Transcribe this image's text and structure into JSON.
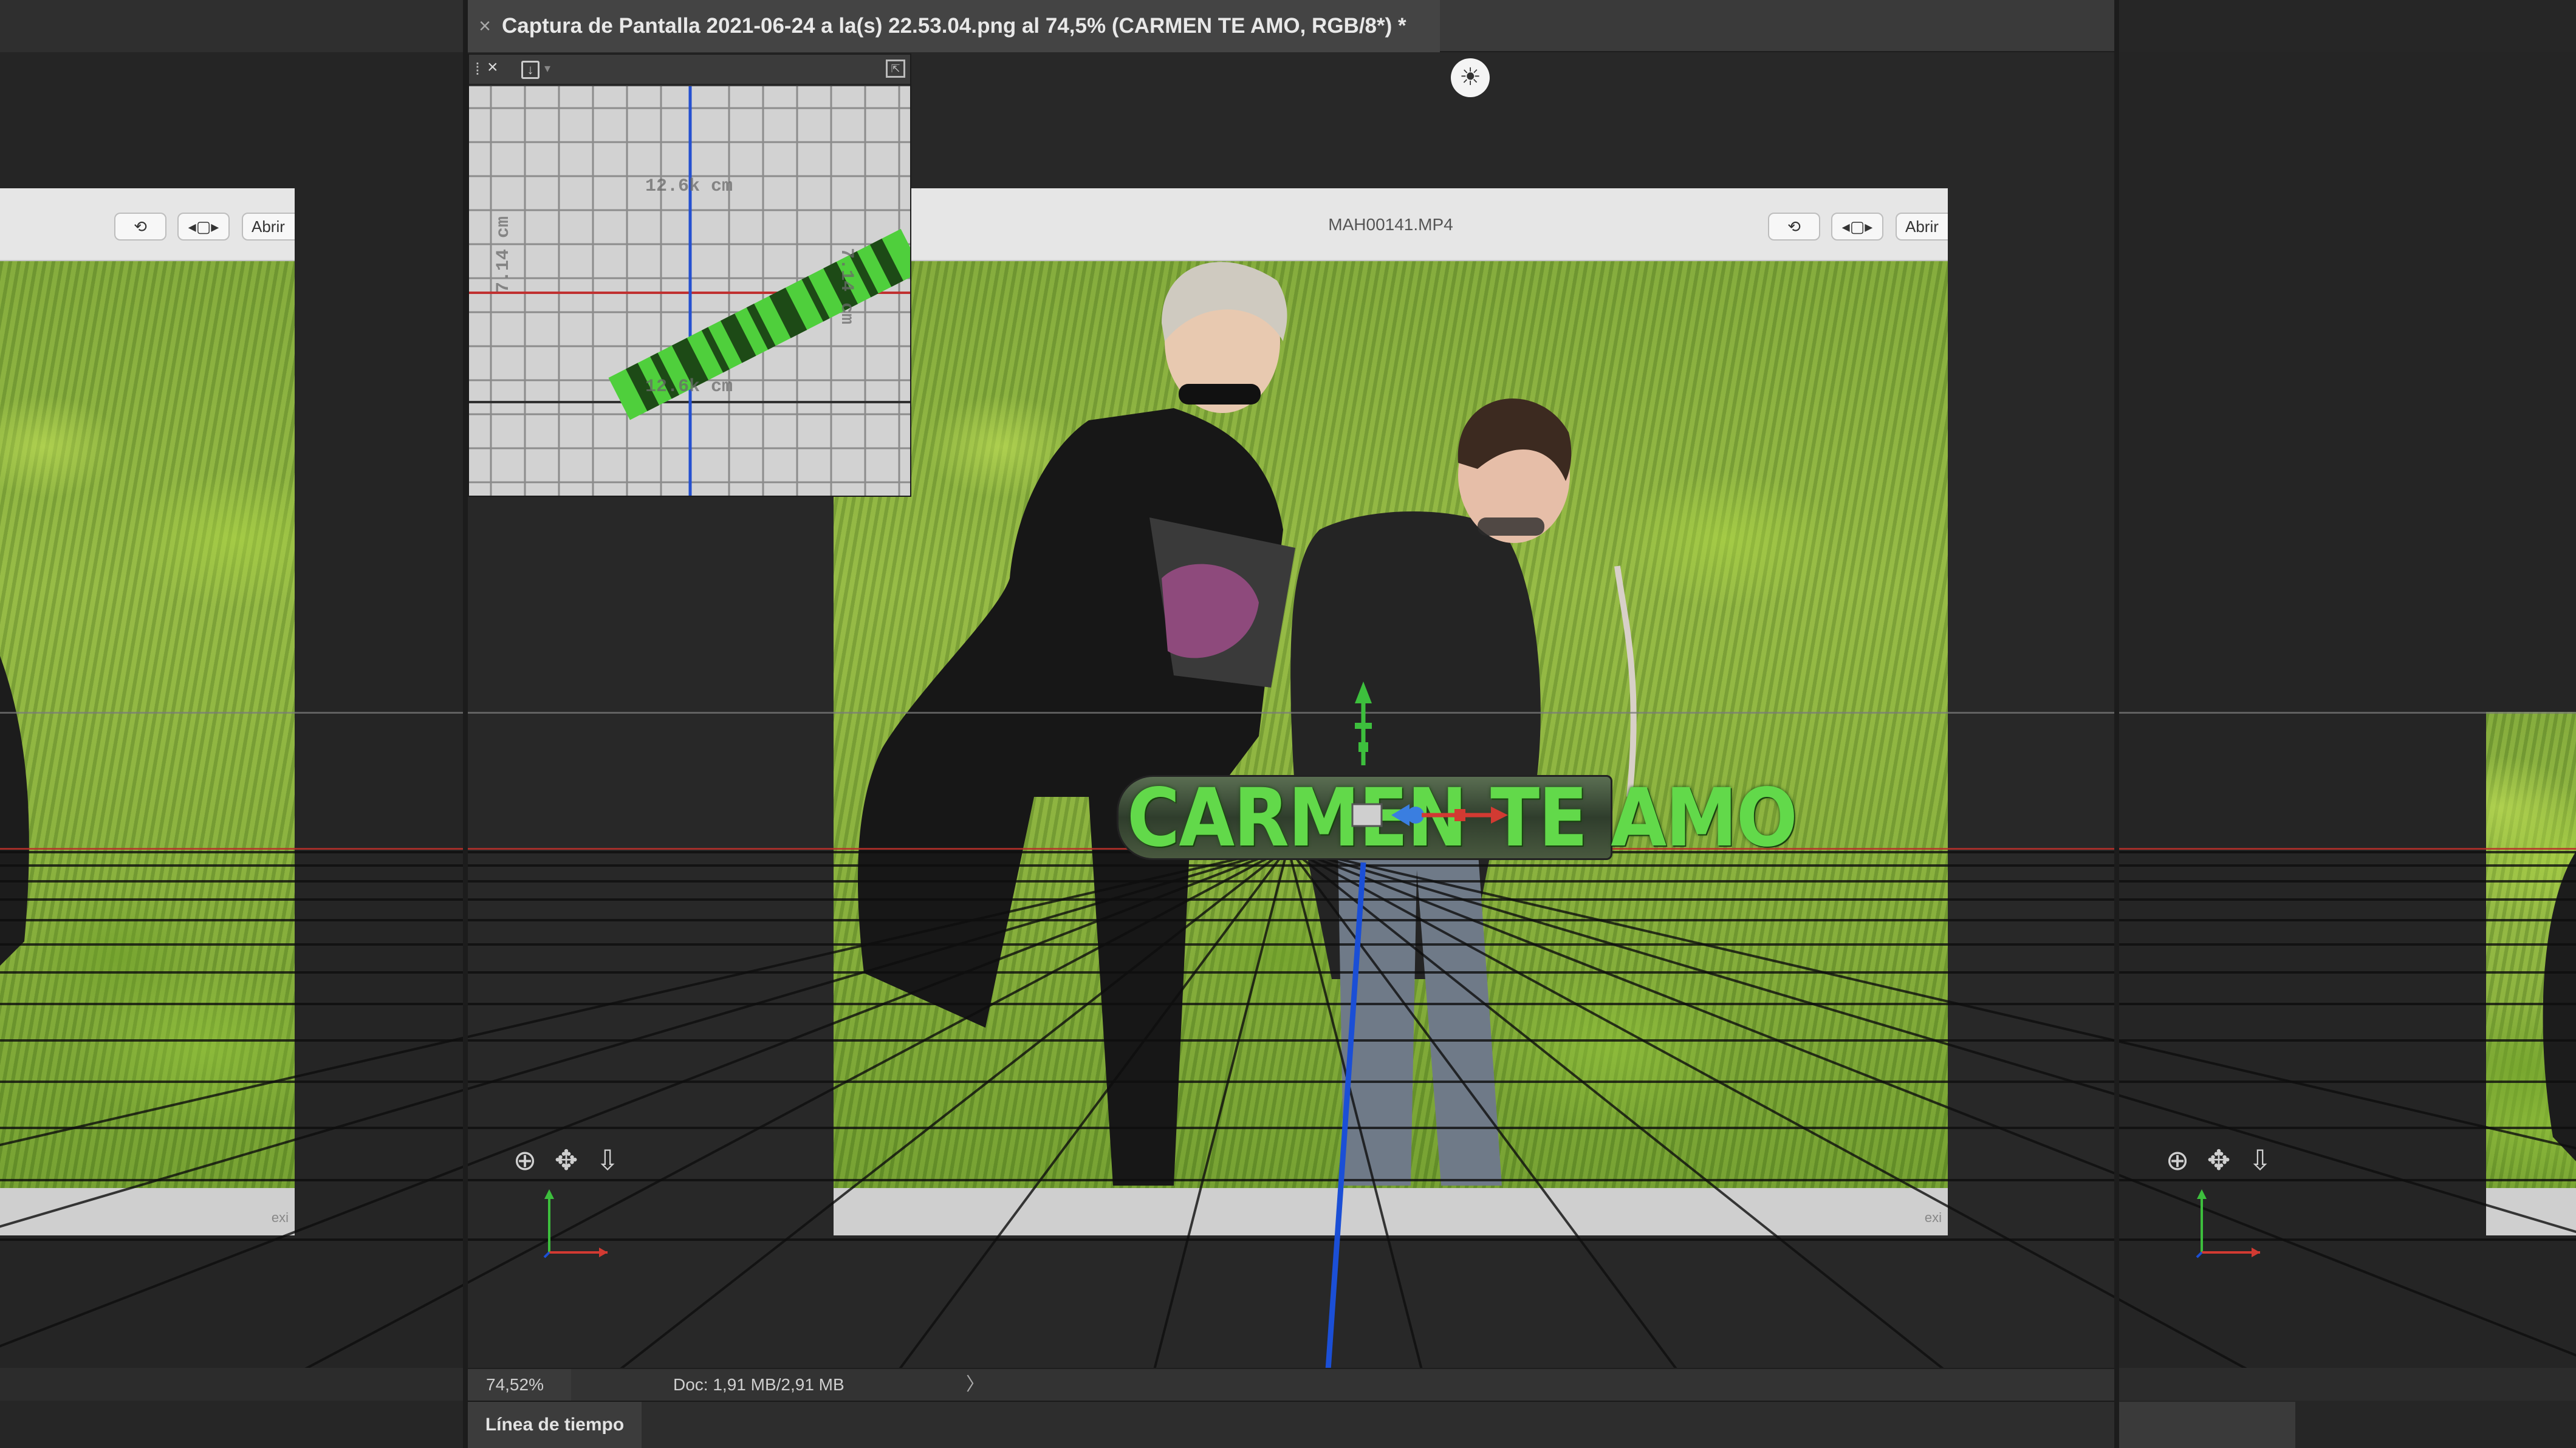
{
  "document_tab": {
    "close_icon": "close-icon",
    "title": "Captura de Pantalla 2021-06-24 a la(s) 22.53.04.png al 74,5% (CARMEN TE AMO, RGB/8*) *"
  },
  "minimap": {
    "close_glyph": "×",
    "grip_glyph": "⁞",
    "icon": "save-view-icon",
    "dropdown_glyph": "▾",
    "expand_icon": "expand-icon",
    "labels": {
      "top": "12.6k cm",
      "bottom": "12.6k cm",
      "left": "7.14 cm",
      "right": "7.14 cm"
    }
  },
  "video_player": {
    "filename": "MAH00141.MP4",
    "open_button": "Abrir",
    "bottom_text": "exi",
    "rotate_icon": "rotate-icon",
    "trim_icon": "trim-icon"
  },
  "text_layer": {
    "text": "CARMEN TE AMO",
    "color": "#62d94a"
  },
  "camera_controls": {
    "orbit_icon": "orbit-icon",
    "pan_icon": "pan-icon",
    "dolly_icon": "dolly-icon"
  },
  "status_bar": {
    "zoom": "74,52%",
    "doc_info": "Doc: 1,91 MB/2,91 MB",
    "arrow": "〉"
  },
  "timeline": {
    "tab_label": "Línea de tiempo"
  },
  "colors": {
    "ground_line": "#b8302a",
    "axis_blue": "#1b4fd6",
    "axis_green": "#3dbf3d",
    "axis_red": "#d23a32",
    "text_green": "#62d94a"
  }
}
